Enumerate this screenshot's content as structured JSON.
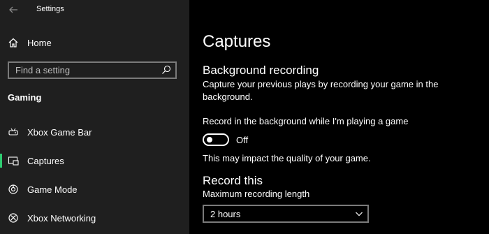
{
  "window": {
    "title": "Settings"
  },
  "sidebar": {
    "home_label": "Home",
    "search_placeholder": "Find a setting",
    "section_title": "Gaming",
    "items": [
      {
        "label": "Xbox Game Bar",
        "icon": "game-bar-icon"
      },
      {
        "label": "Captures",
        "icon": "captures-icon",
        "selected": true
      },
      {
        "label": "Game Mode",
        "icon": "game-mode-icon"
      },
      {
        "label": "Xbox Networking",
        "icon": "xbox-icon"
      }
    ]
  },
  "main": {
    "page_title": "Captures",
    "background_recording": {
      "heading": "Background recording",
      "description": "Capture your previous plays by recording your game in the background.",
      "setting_label": "Record in the background while I'm playing a game",
      "toggle_state": "Off",
      "note": "This may impact the quality of your game."
    },
    "record_this": {
      "heading": "Record this",
      "max_length_label": "Maximum recording length",
      "max_length_value": "2 hours"
    }
  },
  "colors": {
    "sidebar_bg": "#1f1f1f",
    "main_bg": "#000000",
    "accent": "#2ecc71"
  }
}
